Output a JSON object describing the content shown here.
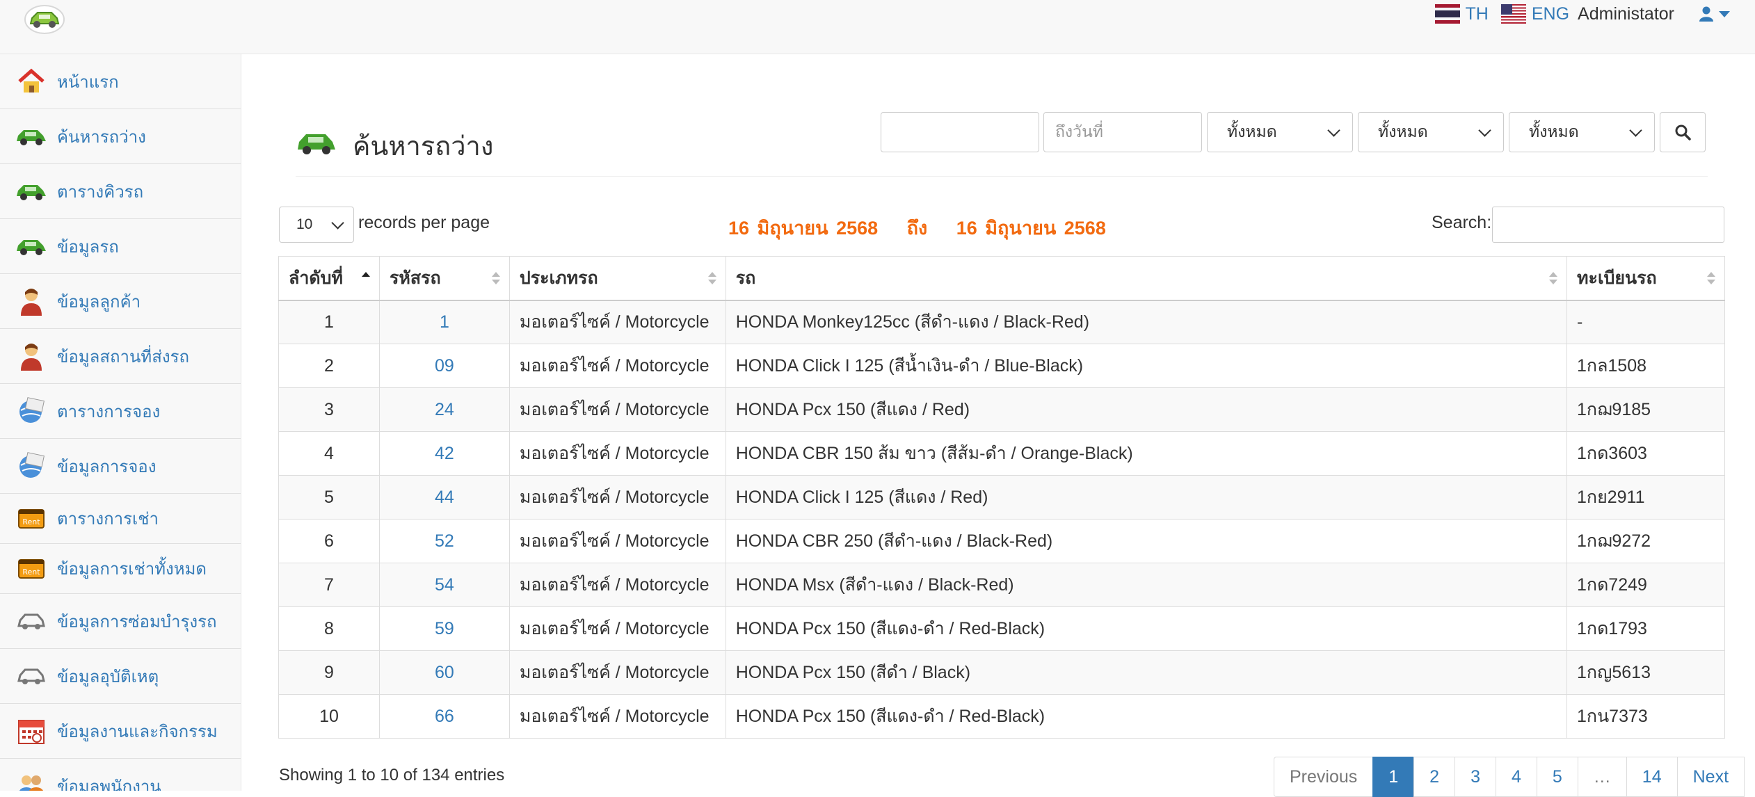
{
  "navbar": {
    "lang_th": "TH",
    "lang_eng": "ENG",
    "admin_name": "Administator"
  },
  "sidebar": {
    "items": [
      {
        "label": "หน้าแรก",
        "icon": "home-icon"
      },
      {
        "label": "ค้นหารถว่าง",
        "icon": "car-icon"
      },
      {
        "label": "ตารางคิวรถ",
        "icon": "car-icon"
      },
      {
        "label": "ข้อมูลรถ",
        "icon": "car-icon"
      },
      {
        "label": "ข้อมูลลูกค้า",
        "icon": "person-icon"
      },
      {
        "label": "ข้อมูลสถานที่ส่งรถ",
        "icon": "person-icon"
      },
      {
        "label": "ตารางการจอง",
        "icon": "globe-icon"
      },
      {
        "label": "ข้อมูลการจอง",
        "icon": "globe-icon"
      },
      {
        "label": "ตารางการเช่า",
        "icon": "rent-icon"
      },
      {
        "label": "ข้อมูลการเช่าทั้งหมด",
        "icon": "rent-icon"
      },
      {
        "label": "ข้อมูลการซ่อมบำรุงรถ",
        "icon": "car-outline-icon"
      },
      {
        "label": "ข้อมูลอุบัติเหตุ",
        "icon": "car-outline-icon"
      },
      {
        "label": "ข้อมูลงานและกิจกรรม",
        "icon": "calendar-icon"
      },
      {
        "label": "ข้อมูลพนักงาน",
        "icon": "people-icon"
      }
    ]
  },
  "header": {
    "title": "ค้นหารถว่าง",
    "from_date_value": "",
    "to_date_placeholder": "ถึงวันที่",
    "filter1": "ทั้งหมด",
    "filter2": "ทั้งหมด",
    "filter3": "ทั้งหมด"
  },
  "controls": {
    "page_length": "10",
    "page_length_label": "records per page",
    "date_from": "16 มิถุนายน 2568",
    "date_sep": "ถึง",
    "date_to": "16 มิถุนายน 2568",
    "search_label": "Search:",
    "search_value": ""
  },
  "table": {
    "headers": [
      "ลำดับที่",
      "รหัสรถ",
      "ประเภทรถ",
      "รถ",
      "ทะเบียนรถ"
    ],
    "rows": [
      [
        "1",
        "1",
        "มอเตอร์ไซค์ / Motorcycle",
        "HONDA Monkey125cc (สีดำ-แดง / Black-Red)",
        "-"
      ],
      [
        "2",
        "09",
        "มอเตอร์ไซค์ / Motorcycle",
        "HONDA Click I 125 (สีน้ำเงิน-ดำ / Blue-Black)",
        "1กล1508"
      ],
      [
        "3",
        "24",
        "มอเตอร์ไซค์ / Motorcycle",
        "HONDA Pcx 150 (สีแดง / Red)",
        "1กฌ9185"
      ],
      [
        "4",
        "42",
        "มอเตอร์ไซค์ / Motorcycle",
        "HONDA CBR 150 ส้ม ขาว (สีส้ม-ดำ / Orange-Black)",
        "1กด3603"
      ],
      [
        "5",
        "44",
        "มอเตอร์ไซค์ / Motorcycle",
        "HONDA Click I 125 (สีแดง / Red)",
        "1กย2911"
      ],
      [
        "6",
        "52",
        "มอเตอร์ไซค์ / Motorcycle",
        "HONDA CBR 250 (สีดำ-แดง / Black-Red)",
        "1กฌ9272"
      ],
      [
        "7",
        "54",
        "มอเตอร์ไซค์ / Motorcycle",
        "HONDA Msx (สีดำ-แดง / Black-Red)",
        "1กด7249"
      ],
      [
        "8",
        "59",
        "มอเตอร์ไซค์ / Motorcycle",
        "HONDA Pcx 150 (สีแดง-ดำ / Red-Black)",
        "1กด1793"
      ],
      [
        "9",
        "60",
        "มอเตอร์ไซค์ / Motorcycle",
        "HONDA Pcx 150 (สีดำ / Black)",
        "1กญ5613"
      ],
      [
        "10",
        "66",
        "มอเตอร์ไซค์ / Motorcycle",
        "HONDA Pcx 150 (สีแดง-ดำ / Red-Black)",
        "1กน7373"
      ]
    ]
  },
  "footer": {
    "info": "Showing 1 to 10 of 134 entries",
    "pages": [
      "Previous",
      "1",
      "2",
      "3",
      "4",
      "5",
      "…",
      "14",
      "Next"
    ]
  },
  "colors": {
    "link": "#337ab7",
    "date_range": "#f26a10",
    "sidebar_bg": "#f8f8f8"
  }
}
